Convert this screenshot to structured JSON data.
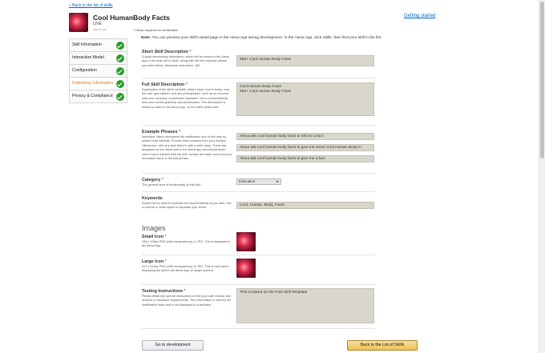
{
  "header": {
    "back_link": "« Back to the list of skills",
    "skill_name": "Cool HumanBody Facts",
    "status": "LIVE",
    "skill_id": "amzn1.ask",
    "getting_started": "Getting started",
    "required_note": "* Fields required for certification"
  },
  "sidebar": {
    "items": [
      {
        "label": "Skill Information",
        "complete": true
      },
      {
        "label": "Interaction Model",
        "complete": true
      },
      {
        "label": "Configuration",
        "complete": true
      },
      {
        "label": "Publishing Information",
        "complete": true
      },
      {
        "label": "Privacy & Compliance",
        "complete": true
      }
    ]
  },
  "note": {
    "prefix": "Note:",
    "text": " You can preview your skill's detail page in the Alexa App during development. In the Alexa App, click Skills, then find your skill in the list."
  },
  "fields": {
    "short_desc": {
      "label": "Short Skill Description",
      "required": "*",
      "help": "A quick introductory description, which will be shown in the Alexa App in the main list of skills, along with the first example phrase you enter below. Maximum characters: 160",
      "value": "555+ Cool Human Body Facts"
    },
    "full_desc": {
      "label": "Full Skill Description",
      "required": "*",
      "help": "Explanation of the skill's benefits, what it does, how it works, how the user gets started, and any prerequisites, such as an account with your company or particular hardware. Use a conversational tone and correct grammar and punctuation. This description is shown to users in the Alexa App, on the skill's detail card.",
      "value": "Cool Human Body Facts\n555+ Cool Human Body Facts"
    },
    "example_phrases": {
      "label": "Example Phrases",
      "required": "*",
      "help": "Important: Many developers fail certification due to this step so please read carefully. Provide three phrases from your Sample Utterances, with any slots filled in with a valid value. These are displayed on the detail card in the Alexa App and should teach users how to interact with the skill. Include the wake word and your invocation name in the first phrase.",
      "values": [
        "Alexa ask cool human body facts to tell me a fact",
        "Alexa ask cool human body facts to give me some Cool Human Body in",
        "Alexa ask cool human body facts to give me a fact"
      ]
    },
    "category": {
      "label": "Category",
      "required": "*",
      "help": "The general area of functionality of this skill.",
      "value": "Education"
    },
    "keywords": {
      "label": "Keywords",
      "help": "Search terms used to increase the discoverability of your skill. Use a comma or white space to separate your terms.",
      "value": "Cool, Human, Body, Facts"
    },
    "images_title": "Images",
    "small_icon": {
      "label": "Small Icon",
      "required": "*",
      "help": "108 x 108px PNG (with transparency) or JPG. This is displayed in the Alexa App."
    },
    "large_icon": {
      "label": "Large Icon",
      "required": "*",
      "help": "512 x 512px PNG (with transparency) or JPG. This is used when displaying the skill in the Alexa App on larger screens."
    },
    "testing": {
      "label": "Testing Instructions",
      "required": "*",
      "help": "Please detail any special instructions to test your skill. Include any account or hardware requirements. This information is used by the certification team and is not displayed to customers.",
      "value": "This is based on the Fact Skill Template"
    }
  },
  "buttons": {
    "go_to_development": "Go to development",
    "back_to_list": "Back to the List of Skills"
  },
  "colors": {
    "link": "#0066c0",
    "active_nav": "#e47911",
    "check": "#2a9c2a",
    "input_bg": "#d9d6cb",
    "primary_button": "#f0c14b"
  }
}
